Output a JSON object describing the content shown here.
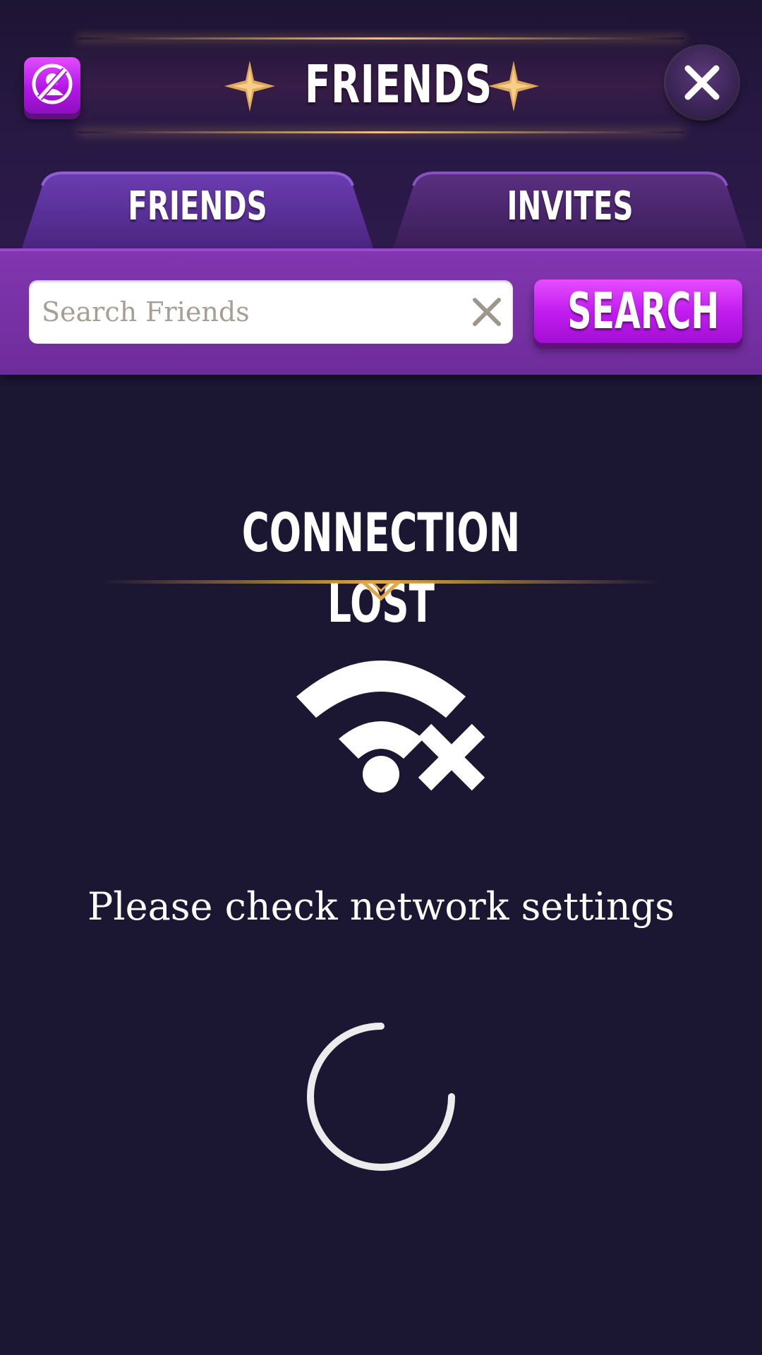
{
  "header": {
    "title": "FRIENDS"
  },
  "tabs": [
    {
      "label": "FRIENDS",
      "active": true
    },
    {
      "label": "INVITES",
      "active": false
    }
  ],
  "search": {
    "placeholder": "Search Friends",
    "value": "",
    "button_label": "SEARCH"
  },
  "status": {
    "title": "CONNECTION LOST",
    "message": "Please check network settings"
  },
  "icons": {
    "privacy": "privacy-off-icon",
    "close": "close-icon",
    "stars": "star-icon",
    "clear": "clear-icon",
    "wifi": "wifi-off-icon",
    "loading": "loading-spinner-icon"
  },
  "colors": {
    "background": "#1b1733",
    "accent_purple": "#c21df0",
    "gold": "#f1c27a",
    "search_bar": "#7a32a8"
  }
}
